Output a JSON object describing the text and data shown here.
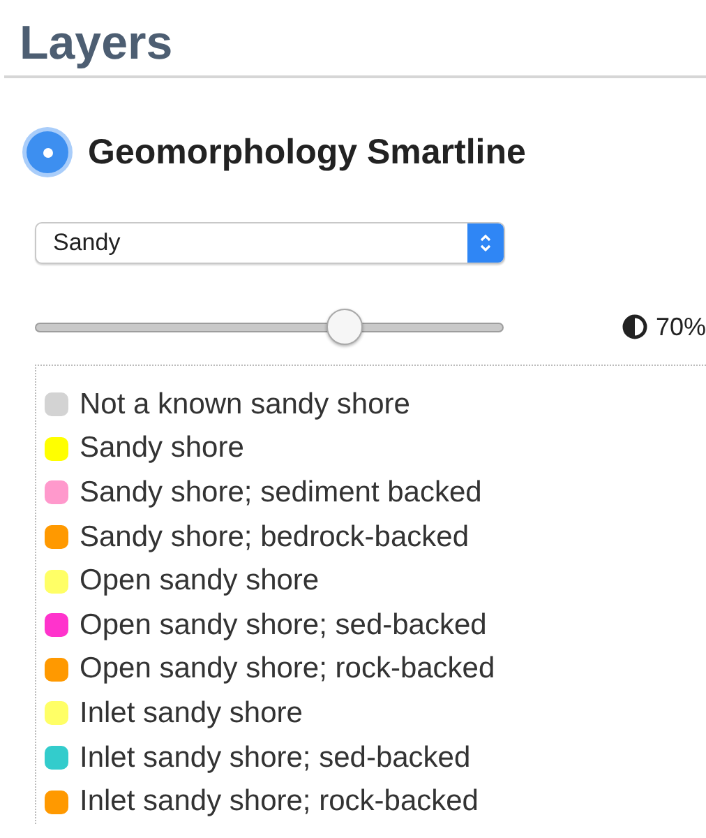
{
  "panel": {
    "title": "Layers"
  },
  "layer": {
    "name": "Geomorphology Smartline",
    "selected": true
  },
  "dropdown": {
    "value": "Sandy"
  },
  "opacity": {
    "level": 0.66,
    "reading": "70%"
  },
  "legend": [
    {
      "label": "Not a known sandy shore",
      "color": "#d3d3d3"
    },
    {
      "label": "Sandy shore",
      "color": "#ffff00"
    },
    {
      "label": "Sandy shore; sediment backed",
      "color": "#ff99cc"
    },
    {
      "label": "Sandy shore; bedrock-backed",
      "color": "#ff9900"
    },
    {
      "label": "Open sandy shore",
      "color": "#ffff66"
    },
    {
      "label": "Open sandy shore; sed-backed",
      "color": "#ff33cc"
    },
    {
      "label": "Open sandy shore; rock-backed",
      "color": "#ff9900"
    },
    {
      "label": "Inlet sandy shore",
      "color": "#ffff66"
    },
    {
      "label": "Inlet sandy shore; sed-backed",
      "color": "#33cccc"
    },
    {
      "label": "Inlet sandy shore; rock-backed",
      "color": "#ff9900"
    }
  ]
}
